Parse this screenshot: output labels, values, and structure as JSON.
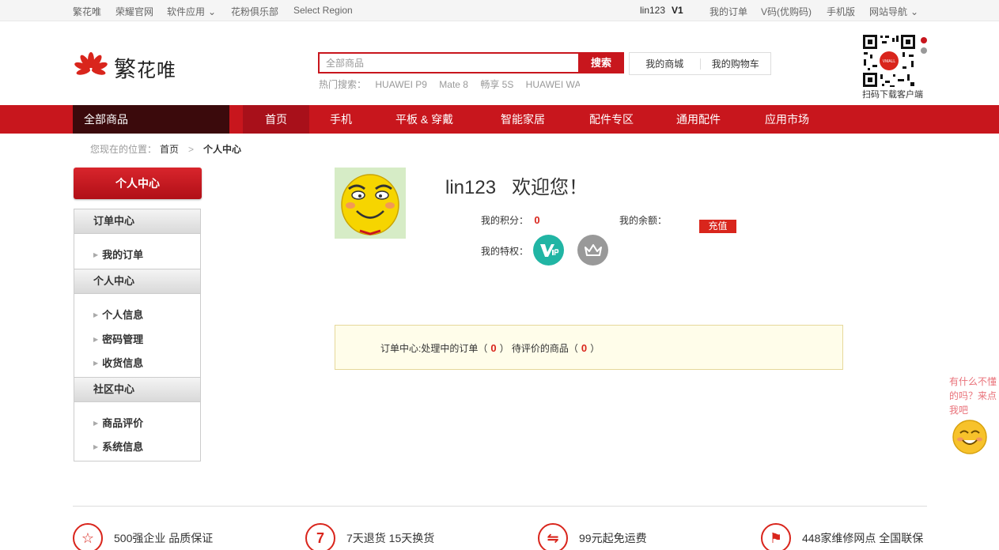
{
  "topbar": {
    "left_links": [
      "繁花唯",
      "荣耀官网",
      "软件应用",
      "花粉俱乐部",
      "Select Region"
    ],
    "user": "lin123",
    "vip_level": "V1",
    "right_links": [
      "我的订单",
      "V码(优购码)",
      "手机版",
      "网站导航"
    ]
  },
  "header": {
    "logo_big": "繁",
    "logo_small": "花唯",
    "search_placeholder": "全部商品",
    "search_button": "搜索",
    "hot_label": "热门搜索：",
    "hot_terms": [
      "HUAWEI P9",
      "Mate 8",
      "畅享 5S",
      "HUAWEI WATCH"
    ],
    "my_mall": "我的商城",
    "my_cart": "我的购物车",
    "qr_label": "扫码下载客户端",
    "qr_badge": "VMALL"
  },
  "nav": {
    "all_goods": "全部商品",
    "items": [
      "首页",
      "手机",
      "平板 & 穿戴",
      "智能家居",
      "配件专区",
      "通用配件",
      "应用市场"
    ]
  },
  "breadcrumb": {
    "prefix": "您现在的位置：",
    "home": "首页",
    "arrow": ">",
    "current": "个人中心"
  },
  "sidebar": {
    "header": "个人中心",
    "sections": [
      {
        "title": "订单中心",
        "items": [
          "我的订单"
        ]
      },
      {
        "title": "个人中心",
        "items": [
          "个人信息",
          "密码管理",
          "收货信息"
        ]
      },
      {
        "title": "社区中心",
        "items": [
          "商品评价",
          "系统信息"
        ]
      }
    ]
  },
  "profile": {
    "username": "lin123",
    "welcome": "欢迎您！",
    "points_label": "我的积分：",
    "points_value": "0",
    "balance_label": "我的余额：",
    "recharge": "充值",
    "privilege_label": "我的特权："
  },
  "orders": {
    "prefix": "订单中心:处理中的订单（",
    "processing": "0",
    "middle": "） 待评价的商品（",
    "to_review": "0",
    "suffix": "）"
  },
  "helper": {
    "text": "有什么不懂的吗？来点我吧"
  },
  "footer": {
    "features": [
      "500强企业 品质保证",
      "7天退货 15天换货",
      "99元起免运费",
      "448家维修网点 全国联保"
    ]
  },
  "colors": {
    "brand_red": "#c8161d",
    "nav_dark": "#3b0a0c",
    "highlight": "#d9251c",
    "order_bg": "#fffdea"
  }
}
